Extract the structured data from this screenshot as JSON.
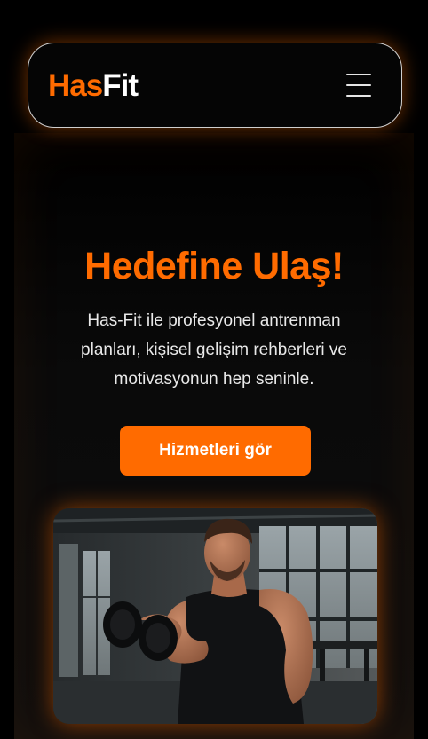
{
  "header": {
    "logo_part1": "Has",
    "logo_part2": "Fit",
    "menu_icon": "hamburger-menu-icon"
  },
  "hero": {
    "title": "Hedefine Ulaş!",
    "description": "Has-Fit ile profesyonel antrenman planları, kişisel gelişim rehberleri ve motivasyonun hep seninle.",
    "cta_label": "Hizmetleri gör"
  },
  "colors": {
    "accent": "#ff6b00",
    "background": "#000000",
    "text": "#e9e9e9"
  }
}
